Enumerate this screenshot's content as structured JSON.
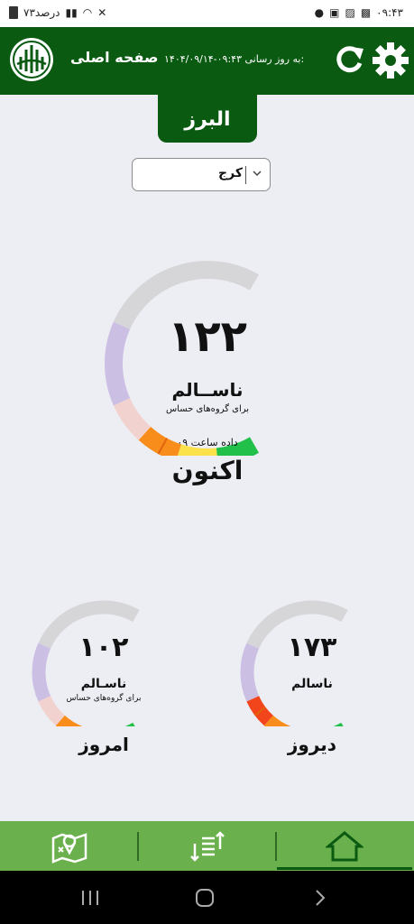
{
  "status_bar": {
    "time": "۰۹:۴۳",
    "battery_text": "۷۳درصد"
  },
  "header": {
    "title": "صفحه اصلی",
    "updated_label": "به روز رسانی:",
    "updated_value": "۱۴۰۴/۰۹/۱۴-۰۹:۴۳",
    "icons": {
      "logo": "environment-logo-icon",
      "refresh": "refresh-icon",
      "settings": "gear-icon"
    }
  },
  "province": "البرز",
  "city_select": {
    "selected": "کرج"
  },
  "current": {
    "value": "۱۲۲",
    "status": "ناســالم",
    "sub": "برای گروه‌های حساس",
    "hour": "داده ساعت ۰۹",
    "label": "اکنون",
    "level_fraction": 0.244
  },
  "today": {
    "value": "۱۰۲",
    "status": "ناسـالم",
    "sub": "برای گروه‌های حساس",
    "label": "امروز",
    "level_fraction": 0.204
  },
  "yesterday": {
    "value": "۱۷۳",
    "status": "ناسالم",
    "label": "دیروز",
    "level_fraction": 0.346
  },
  "gauge_colors": {
    "good": "#20c04a",
    "moderate": "#fbe24b",
    "sensitive": "#f98d1c",
    "unhealthy": "#f2451c",
    "very_unhealthy": "#ccbfe4",
    "hazardous": "#d6d6d8",
    "faded_sensitive": "#f2dcc4",
    "faded_unhealthy": "#f2d2cf"
  },
  "bottom_nav": {
    "items": [
      {
        "icon": "map-icon"
      },
      {
        "icon": "sort-list-icon"
      },
      {
        "icon": "home-icon",
        "active": true
      }
    ]
  },
  "system_nav": {
    "icons": [
      "recent-apps-icon",
      "home-circle-icon",
      "back-chevron-icon"
    ]
  }
}
